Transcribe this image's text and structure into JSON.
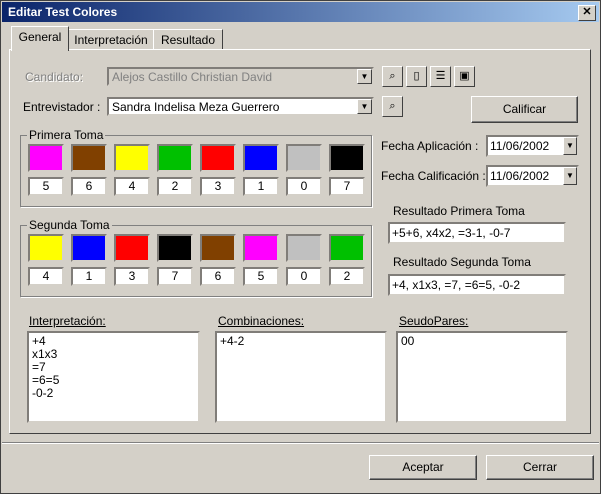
{
  "window": {
    "title": "Editar Test Colores",
    "close_glyph": "✕"
  },
  "tabs": [
    {
      "label": "General",
      "active": true
    },
    {
      "label": "Interpretación",
      "active": false
    },
    {
      "label": "Resultado",
      "active": false
    }
  ],
  "general": {
    "candidato_label": "Candidato:",
    "candidato_value": "Alejos Castillo Christian David",
    "entrevistador_label": "Entrevistador :",
    "entrevistador_value": "Sandra Indelisa Meza Guerrero",
    "calificar_label": "Calificar",
    "fecha_aplicacion_label": "Fecha Aplicación :",
    "fecha_aplicacion_value": "11/06/2002",
    "fecha_calificacion_label": "Fecha Calificación :",
    "fecha_calificacion_value": "11/06/2002",
    "primera_toma": {
      "label": "Primera Toma",
      "colors": [
        "#ff00ff",
        "#804000",
        "#ffff00",
        "#00c000",
        "#ff0000",
        "#0000ff",
        "#c0c0c0",
        "#000000"
      ],
      "numbers": [
        "5",
        "6",
        "4",
        "2",
        "3",
        "1",
        "0",
        "7"
      ]
    },
    "segunda_toma": {
      "label": "Segunda Toma",
      "colors": [
        "#ffff00",
        "#0000ff",
        "#ff0000",
        "#000000",
        "#804000",
        "#ff00ff",
        "#c0c0c0",
        "#00c000"
      ],
      "numbers": [
        "4",
        "1",
        "3",
        "7",
        "6",
        "5",
        "0",
        "2"
      ]
    },
    "resultado_primera_label": "Resultado Primera Toma",
    "resultado_primera_value": "+5+6, x4x2, =3-1, -0-7",
    "resultado_segunda_label": "Resultado Segunda Toma",
    "resultado_segunda_value": "+4, x1x3, =7, =6=5, -0-2",
    "interpretacion_label": "Interpretación:",
    "interpretacion_items": [
      "+4",
      "x1x3",
      "=7",
      "=6=5",
      "-0-2"
    ],
    "combinaciones_label": "Combinaciones:",
    "combinaciones_items": [
      "+4-2"
    ],
    "seudopares_label": "SeudoPares:",
    "seudopares_items": [
      "00"
    ]
  },
  "footer": {
    "aceptar_label": "Aceptar",
    "cerrar_label": "Cerrar"
  },
  "icons": [
    "binoculars-icon",
    "new-document-icon",
    "document-list-icon",
    "properties-icon",
    "binoculars-icon"
  ]
}
